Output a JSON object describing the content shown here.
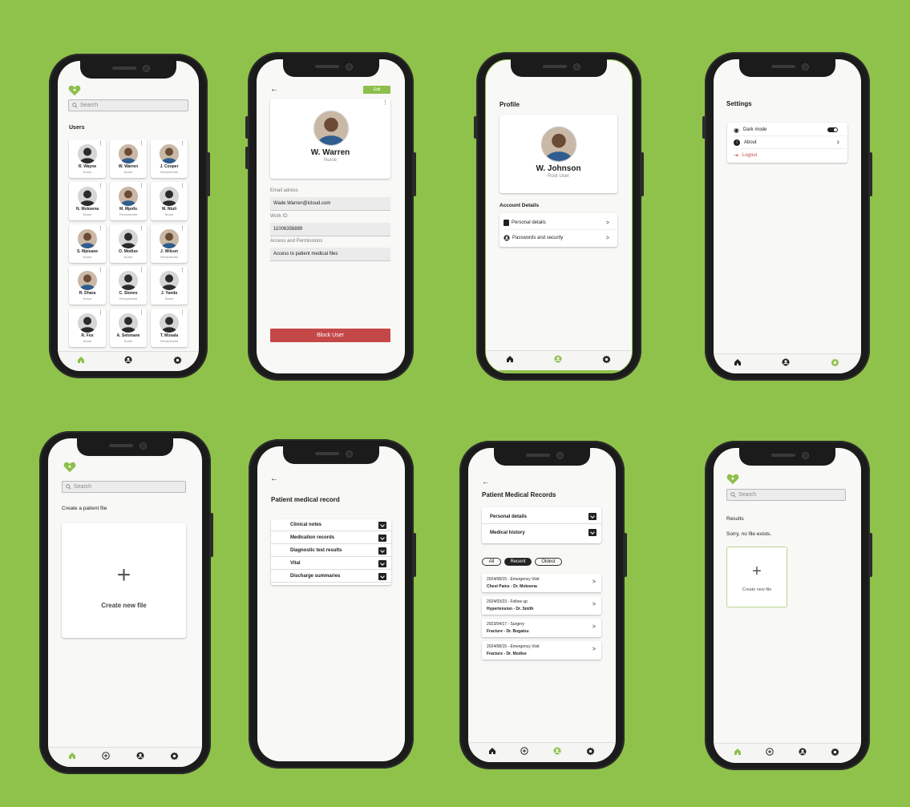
{
  "colors": {
    "background": "#8fc24a",
    "accent": "#8cc04a",
    "danger": "#c54848"
  },
  "s1": {
    "search_placeholder": "Search",
    "users_title": "Users",
    "users": [
      {
        "name": "R. Wayne",
        "role": "Nurse",
        "photo": false
      },
      {
        "name": "W. Warren",
        "role": "Nurse",
        "photo": true
      },
      {
        "name": "J. Cooper",
        "role": "Receptionist",
        "photo": true
      },
      {
        "name": "N. Mokoena",
        "role": "Nurse",
        "photo": false
      },
      {
        "name": "M. Mpofu",
        "role": "Receptionist",
        "photo": true
      },
      {
        "name": "M. Ntuli",
        "role": "Nurse",
        "photo": false
      },
      {
        "name": "S. Mpisane",
        "role": "Nurse",
        "photo": true
      },
      {
        "name": "O. Modise",
        "role": "Nurse",
        "photo": false
      },
      {
        "name": "J. Wilson",
        "role": "Receptionist",
        "photo": true
      },
      {
        "name": "R. Dhara",
        "role": "Nurse",
        "photo": true
      },
      {
        "name": "C. Stones",
        "role": "Receptionist",
        "photo": false
      },
      {
        "name": "J. Yanda",
        "role": "Nurse",
        "photo": false
      },
      {
        "name": "R. Fox",
        "role": "Nurse",
        "photo": false
      },
      {
        "name": "A. Setonane",
        "role": "Nurse",
        "photo": false
      },
      {
        "name": "T. Mosala",
        "role": "Receptionist",
        "photo": false
      }
    ]
  },
  "s2": {
    "edit": "Edit",
    "name": "W. Warren",
    "role": "Nurse",
    "email_label": "Email adress",
    "email": "Wade.Warren@icloud.com",
    "work_label": "Work ID",
    "work_id": "11006356889",
    "access_label": "Access and Permissions",
    "access": "Access to patient medical files",
    "block": "Block User"
  },
  "s3": {
    "title": "Profile",
    "name": "W. Johnson",
    "role": "Root User",
    "account": "Account Details",
    "items": [
      "Personal details",
      "Passwords and security"
    ]
  },
  "s4": {
    "title": "Settings",
    "dark": "Dark mode",
    "about": "About",
    "logout": "Logout"
  },
  "s5": {
    "search_placeholder": "Search",
    "title": "Create a patient file",
    "create": "Create new file"
  },
  "s6": {
    "title": "Patient medical record",
    "items": [
      "Clinical notes",
      "Medication records",
      "Diagnostic test results",
      "Vital",
      "Discharge summaries"
    ]
  },
  "s7": {
    "title": "Patient Medical Records",
    "sections": [
      "Personal details",
      "Medical history"
    ],
    "filters": [
      "All",
      "Recent",
      "Oldest"
    ],
    "records": [
      {
        "date": "2024/08/15",
        "type": "- Emergency Visit",
        "detail": "Chest Pains - Dr. Mokoena"
      },
      {
        "date": "2024/03/23",
        "type": "- Follow up",
        "detail": "Hypertension - Dr. Smith"
      },
      {
        "date": "2023/04/17",
        "type": "- Surgery",
        "detail": "Fracture - Dr. Bogatsu"
      },
      {
        "date": "2024/08/15",
        "type": "- Emergency Visit",
        "detail": "Fracture - Dr. Modise"
      }
    ]
  },
  "s8": {
    "search_placeholder": "Search",
    "results": "Results",
    "none": "Sorry, no file exists.",
    "create": "Create new file"
  }
}
